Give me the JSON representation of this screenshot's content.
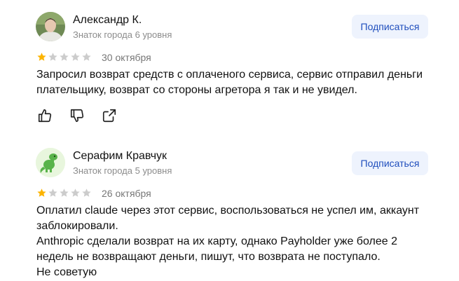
{
  "reviews": [
    {
      "author": "Александр К.",
      "level": "Знаток города 6 уровня",
      "subscribe_label": "Подписаться",
      "rating": 1,
      "rating_max": 5,
      "date": "30 октября",
      "text": "Запросил возврат средств с оплаченого сервиса, сервис отправил деньги\nплательщику, возврат со стороны агретора я так и не увидел.",
      "actions": [
        "like-icon",
        "dislike-icon",
        "share-icon"
      ]
    },
    {
      "author": "Серафим Кравчук",
      "level": "Знаток города 5 уровня",
      "subscribe_label": "Подписаться",
      "rating": 1,
      "rating_max": 5,
      "date": "26 октября",
      "text": "Оплатил claude через этот сервис, воспользоваться не успел им, аккаунт\nзаблокировали.\nAnthropic сделали возврат на их карту, однако Payholder уже более 2\nнедель не возвращают деньги, пишут, что возврата не поступало.\nНе советую"
    }
  ],
  "colors": {
    "star_filled": "#fcb400",
    "star_empty": "#cccccc",
    "subscribe_bg": "#eef3fd",
    "subscribe_text": "#1f4ebd",
    "secondary_text": "#8c8c8c"
  }
}
